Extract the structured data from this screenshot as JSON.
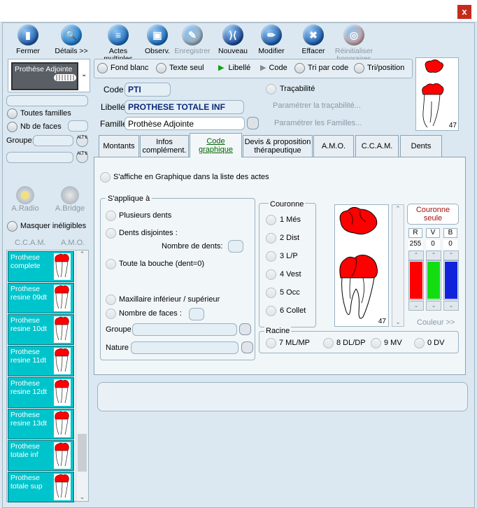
{
  "title_bar": {
    "close": "x"
  },
  "toolbar": [
    {
      "id": "fermer",
      "label": "Fermer",
      "color": "#1f5fb0",
      "glyph": "▮",
      "enabled": true
    },
    {
      "id": "details",
      "label": "Détails >>",
      "color": "#1f7fd0",
      "glyph": "🔍",
      "enabled": true
    },
    {
      "id": "actes",
      "label": "Actes multiples",
      "color": "#1f6fc0",
      "glyph": "≡",
      "enabled": true
    },
    {
      "id": "observ",
      "label": "Observ.",
      "color": "#1f6fc0",
      "glyph": "▣",
      "enabled": true
    },
    {
      "id": "enregistrer",
      "label": "Enregistrer",
      "color": "#9bb0c0",
      "glyph": "✎",
      "enabled": false
    },
    {
      "id": "nouveau",
      "label": "Nouveau",
      "color": "#1f4fa0",
      "glyph": "⟩⟨",
      "enabled": true
    },
    {
      "id": "modifier",
      "label": "Modifier",
      "color": "#1f5fb0",
      "glyph": "✏",
      "enabled": true
    },
    {
      "id": "effacer",
      "label": "Effacer",
      "color": "#1f5fb0",
      "glyph": "✖",
      "enabled": true
    },
    {
      "id": "honoraires",
      "label": "Réinitialiser honoraires",
      "color": "#c9a8a8",
      "glyph": "◎",
      "enabled": false
    }
  ],
  "left": {
    "famille_box": "Prothèse Adjointe",
    "toutes_familles": "Toutes familles",
    "nb_faces": "Nb de faces",
    "groupe": "Groupe:",
    "alt": "ALT",
    "a_radio": "A.Radio",
    "a_bridge": "A.Bridge",
    "masquer": "Masquer inéligibles",
    "col_ccam": "C.C.A.M.",
    "col_amo": "A.M.O.",
    "items": [
      "Prothese complete",
      "Prothese resine 09dt",
      "Prothese resine 10dt",
      "Prothese resine 11dt",
      "Prothese resine 12dt",
      "Prothese resine 13dt",
      "Prothese totale inf",
      "Prothese totale sup"
    ]
  },
  "options": {
    "fond_blanc": "Fond blanc",
    "texte_seul": "Texte seul",
    "libelle": "Libellé",
    "code": "Code",
    "tri_code": "Tri par code",
    "tri_position": "Tri/position"
  },
  "form": {
    "code_label": "Code",
    "code_value": "PTI",
    "libelle_label": "Libellé",
    "libelle_value": "PROTHESE TOTALE INF",
    "famille_label": "Famille",
    "famille_value": "Prothèse Adjointe",
    "tracabilite": "Traçabilité",
    "param_tracabilite": "Paramétrer la traçabilité...",
    "param_familles": "Paramétrer les Familles..."
  },
  "preview_number": "47",
  "tabs": [
    "Montants",
    "Infos complément.",
    "Code graphique",
    "Devis & proposition thérapeutique",
    "A.M.O.",
    "C.C.A.M.",
    "Dents"
  ],
  "graphique": {
    "saffiche": "S'affiche en Graphique dans la liste des actes",
    "sapplique": "S'applique à",
    "plusieurs": "Plusieurs dents",
    "disjointes": "Dents disjointes :",
    "nombre_dents": "Nombre de dents:",
    "toute_bouche": "Toute la bouche (dent=0)",
    "maxillaire": "Maxillaire inférieur / supérieur",
    "nombre_faces": "Nombre de faces :",
    "groupe": "Groupe",
    "nature": "Nature",
    "couronne": "Couronne",
    "faces": [
      "1 Més",
      "2 Dist",
      "3 L/P",
      "4 Vest",
      "5 Occ",
      "6 Collet"
    ],
    "tooth_number": "47",
    "couronne_seule": "Couronne seule",
    "rgb_labels": [
      "R",
      "V",
      "B"
    ],
    "rgb_values": [
      "255",
      "0",
      "0"
    ],
    "couleur": "Couleur >>",
    "racine": "Racine",
    "racine_items": [
      "7 ML/MP",
      "8 DL/DP",
      "9 MV",
      "0 DV"
    ]
  },
  "colors": {
    "tooth_red": "#ff0000",
    "list_cyan": "#00c4cc",
    "active_tab_text": "#006400"
  }
}
